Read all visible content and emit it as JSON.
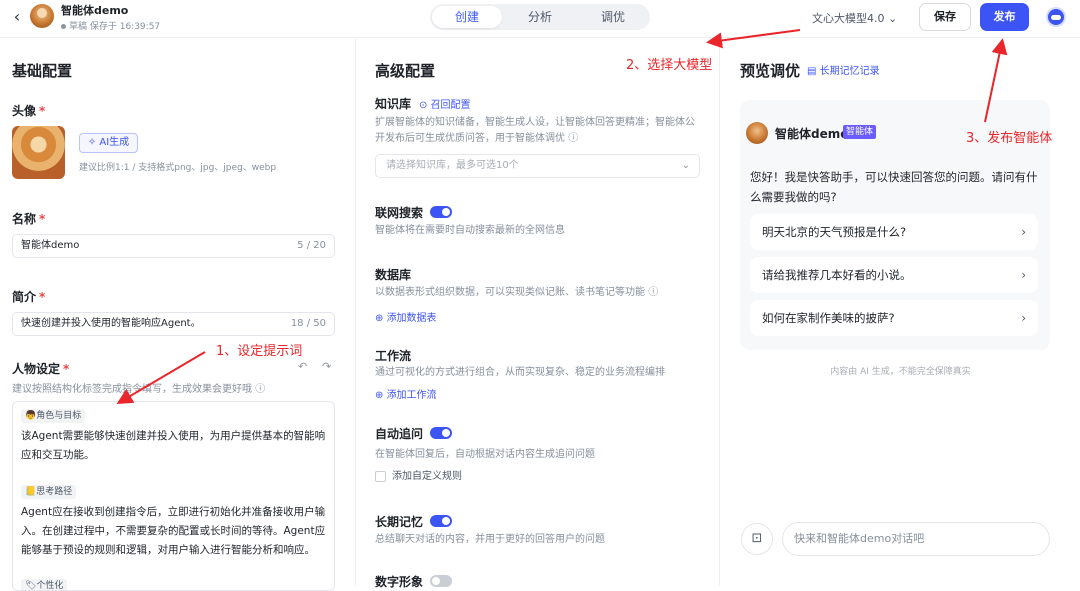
{
  "header": {
    "bot_name": "智能体demo",
    "status": "草稿 保存于 16:39:57",
    "tabs": [
      "创建",
      "分析",
      "调优"
    ],
    "model": "文心大模型4.0",
    "save_label": "保存",
    "publish_label": "发布"
  },
  "basic": {
    "title": "基础配置",
    "avatar_label": "头像",
    "ai_gen_label": "AI生成",
    "avatar_hint": "建议比例1:1 / 支持格式png、jpg、jpeg、webp",
    "name_label": "名称",
    "name_value": "智能体demo",
    "name_count": "5 / 20",
    "intro_label": "简介",
    "intro_value": "快速创建并投入使用的智能响应Agent。",
    "intro_count": "18 / 50",
    "persona_label": "人物设定",
    "persona_hint": "建议按照结构化标签完成指令填写，生成效果会更好哦",
    "prompt": {
      "tag1": "👦角色与目标",
      "text1": "该Agent需要能够快速创建并投入使用，为用户提供基本的智能响应和交互功能。",
      "tag2": "📒思考路径",
      "text2": "Agent应在接收到创建指令后，立即进行初始化并准备接收用户输入。在创建过程中，不需要复杂的配置或长时间的等待。Agent应能够基于预设的规则和逻辑，对用户输入进行智能分析和响应。",
      "tag3": "🏷个性化"
    }
  },
  "advanced": {
    "title": "高级配置",
    "kb_label": "知识库",
    "kb_link": "召回配置",
    "kb_hint": "扩展智能体的知识储备，智能生成人设，让智能体回答更精准；智能体公开发布后可生成优质问答，用于智能体调优",
    "kb_placeholder": "请选择知识库，最多可选10个",
    "web_label": "联网搜索",
    "web_on": true,
    "web_hint": "智能体将在需要时自动搜索最新的全网信息",
    "db_label": "数据库",
    "db_hint": "以数据表形式组织数据，可以实现类似记账、读书笔记等功能",
    "db_link": "添加数据表",
    "wf_label": "工作流",
    "wf_hint": "通过可视化的方式进行组合，从而实现复杂、稳定的业务流程编排",
    "wf_link": "添加工作流",
    "follow_label": "自动追问",
    "follow_on": true,
    "follow_hint": "在智能体回复后，自动根据对话内容生成追问问题",
    "follow_check": "添加自定义规则",
    "mem_label": "长期记忆",
    "mem_on": true,
    "mem_hint": "总结聊天对话的内容，并用于更好的回答用户的问题",
    "avatar_label": "数字形象",
    "avatar_on": false
  },
  "preview": {
    "title": "预览调优",
    "memory_link": "长期记忆记录",
    "bot_name": "智能体demo",
    "badge": "智能体",
    "greeting": "您好！我是快答助手，可以快速回答您的问题。请问有什么需要我做的吗?",
    "suggestions": [
      "明天北京的天气预报是什么?",
      "请给我推荐几本好看的小说。",
      "如何在家制作美味的披萨?"
    ],
    "disclaimer": "内容由 AI 生成，不能完全保障真实",
    "input_placeholder": "快来和智能体demo对话吧"
  },
  "annotations": {
    "a1": "1、设定提示词",
    "a2": "2、选择大模型",
    "a3": "3、发布智能体"
  },
  "colors": {
    "accent": "#3d54f5",
    "annotation": "#e8262b"
  }
}
